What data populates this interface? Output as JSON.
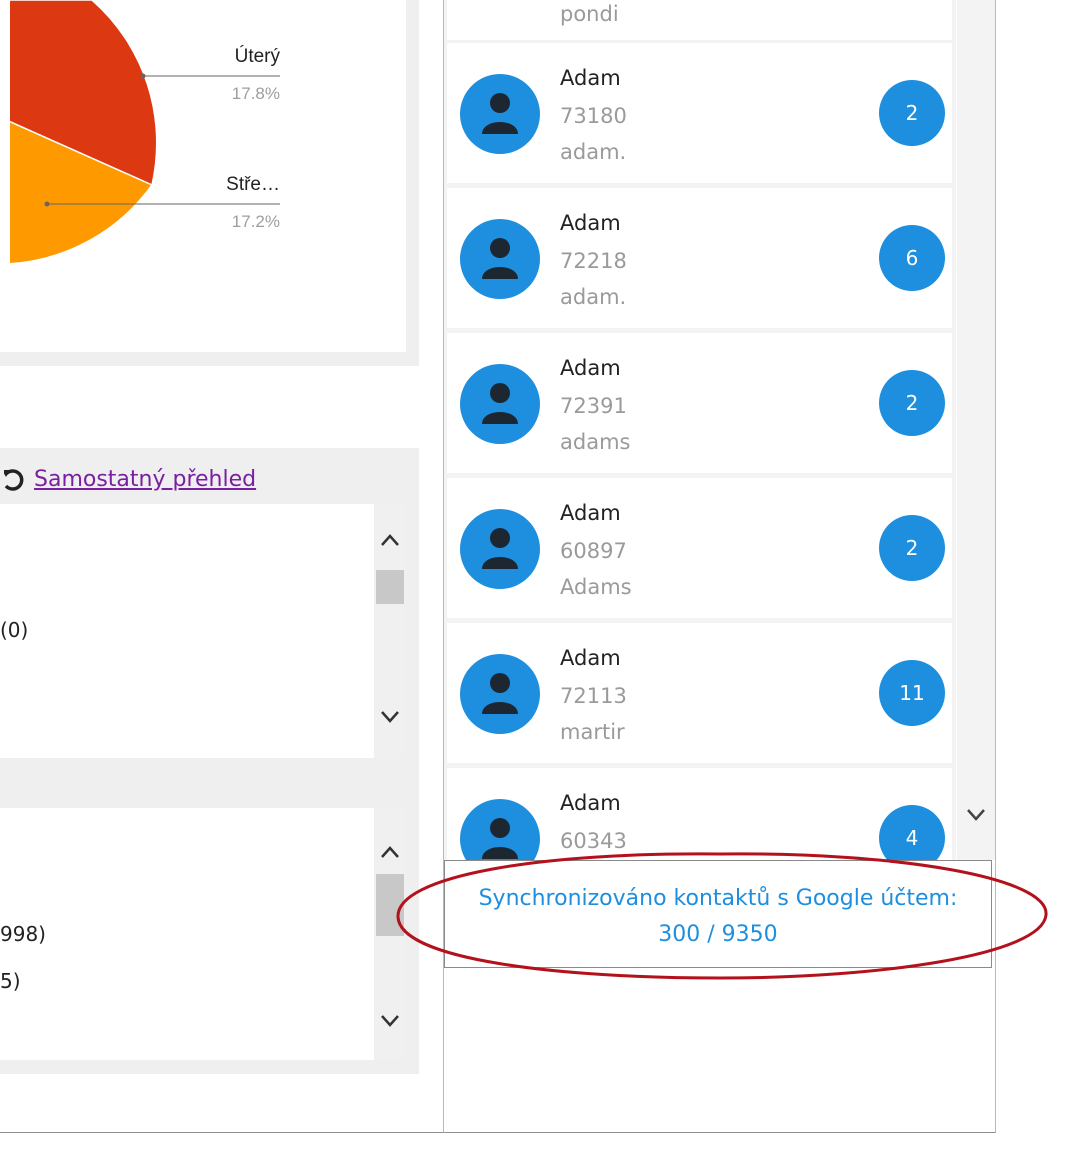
{
  "pie_chart": {
    "slices": [
      {
        "label": "Úterý",
        "percent": "17.8%",
        "color": "#dc3912"
      },
      {
        "label": "Stře…",
        "percent": "17.2%",
        "color": "#ff9900"
      }
    ],
    "other_color": "#3366cc"
  },
  "widget_refresh": {
    "link_label": "Samostatný přehled",
    "list_text": "(0)"
  },
  "widget_second": {
    "lines": [
      "998)",
      "5)"
    ]
  },
  "contacts": [
    {
      "name": "",
      "phone": "",
      "email": "pondi",
      "badge": ""
    },
    {
      "name": "Adam",
      "phone": "73180",
      "email": "adam.",
      "badge": "2"
    },
    {
      "name": "Adam",
      "phone": "72218",
      "email": "adam.",
      "badge": "6"
    },
    {
      "name": "Adam",
      "phone": "72391",
      "email": "adams",
      "badge": "2"
    },
    {
      "name": "Adam",
      "phone": "60897",
      "email": "Adams",
      "badge": "2"
    },
    {
      "name": "Adam",
      "phone": "72113",
      "email": "martir",
      "badge": "11"
    },
    {
      "name": "Adam",
      "phone": "60343",
      "email": "",
      "badge": "4"
    }
  ],
  "sync_status": {
    "label": "Synchronizováno kontaktů s Google účtem:",
    "count": "300 / 9350"
  },
  "colors": {
    "accent": "#1e8fde",
    "link": "#7a1fa2",
    "annotation": "#b3121c"
  }
}
